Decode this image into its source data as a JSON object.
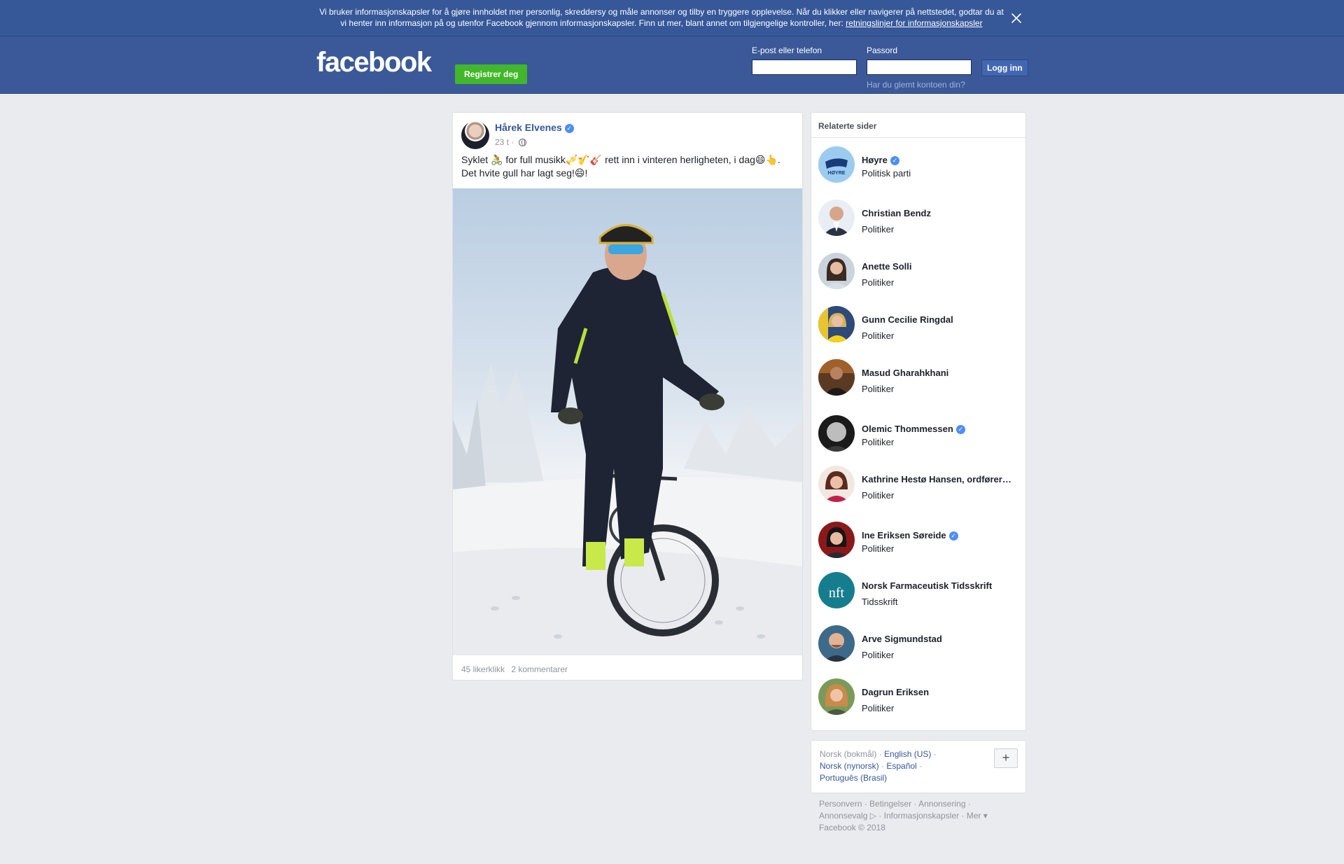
{
  "cookie_banner": {
    "text": "Vi bruker informasjonskapsler for å gjøre innholdet mer personlig, skreddersy og måle annonser og tilby en tryggere opplevelse. Når du klikker eller navigerer på nettstedet, godtar du at vi henter inn informasjon på og utenfor Facebook gjennom informasjonskapsler. Finn ut mer, blant annet om tilgjengelige kontroller, her:",
    "link": "retningslinjer for informasjonskapsler"
  },
  "header": {
    "logo": "facebook",
    "register": "Registrer deg",
    "email_label": "E-post eller telefon",
    "password_label": "Passord",
    "login": "Logg inn",
    "forgot": "Har du glemt kontoen din?"
  },
  "post": {
    "author": "Hårek Elvenes",
    "time": "23 t",
    "text_line1": "Syklet 🚴 for full musikk🎺🎷🎸 rett inn i vinteren herligheten, i dag😄👆.",
    "text_line2": "Det hvite gull har lagt seg!😄!",
    "likes": "45 likerklikk",
    "comments": "2 kommentarer"
  },
  "related": {
    "title": "Relaterte sider",
    "items": [
      {
        "name": "Høyre",
        "type": "Politisk parti",
        "verified": true
      },
      {
        "name": "Christian Bendz",
        "type": "Politiker",
        "verified": false
      },
      {
        "name": "Anette Solli",
        "type": "Politiker",
        "verified": false
      },
      {
        "name": "Gunn Cecilie Ringdal",
        "type": "Politiker",
        "verified": false
      },
      {
        "name": "Masud Gharahkhani",
        "type": "Politiker",
        "verified": false
      },
      {
        "name": "Olemic Thommessen",
        "type": "Politiker",
        "verified": true
      },
      {
        "name": "Kathrine Hestø Hansen, ordfører…",
        "type": "Politiker",
        "verified": false
      },
      {
        "name": "Ine Eriksen Søreide",
        "type": "Politiker",
        "verified": true
      },
      {
        "name": "Norsk Farmaceutisk Tidsskrift",
        "type": "Tidsskrift",
        "verified": false
      },
      {
        "name": "Arve Sigmundstad",
        "type": "Politiker",
        "verified": false
      },
      {
        "name": "Dagrun Eriksen",
        "type": "Politiker",
        "verified": false
      }
    ]
  },
  "languages": {
    "current": "Norsk (bokmål)",
    "en": "English (US)",
    "nn": "Norsk (nynorsk)",
    "es": "Español",
    "pt": "Português (Brasil)",
    "plus": "+"
  },
  "footer": {
    "privacy": "Personvern",
    "terms": "Betingelser",
    "ads": "Annonsering",
    "adchoices": "Annonsevalg",
    "cookies": "Informasjonskapsler",
    "more": "Mer",
    "copyright": "Facebook © 2018"
  },
  "colors": {
    "brand": "#3b5998",
    "register_green": "#42b72a",
    "link": "#365899",
    "background": "#e9ebee"
  }
}
